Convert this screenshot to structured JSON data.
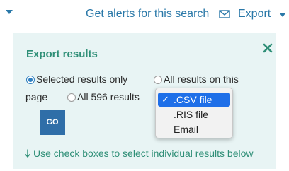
{
  "toolbar": {
    "alerts_label": "Get alerts for this search",
    "export_label": "Export"
  },
  "export_panel": {
    "title": "Export results",
    "options": {
      "selected_only": "Selected results only",
      "all_on_page_line1": "All results on this",
      "all_on_page_line2": "page",
      "all_results": "All 596 results"
    },
    "selected_option": "selected_only",
    "go_label": "GO",
    "hint": "Use check boxes to select individual results below"
  },
  "format_dropdown": {
    "check_mark": "✓",
    "options": [
      ".CSV file",
      ".RIS file",
      "Email"
    ],
    "selected": ".CSV file"
  },
  "colors": {
    "link": "#2a78a8",
    "panel_bg": "#e8f4f4",
    "panel_accent": "#2f8f77",
    "go_button": "#2f6ea8",
    "dropdown_highlight": "#1f6fe8"
  }
}
